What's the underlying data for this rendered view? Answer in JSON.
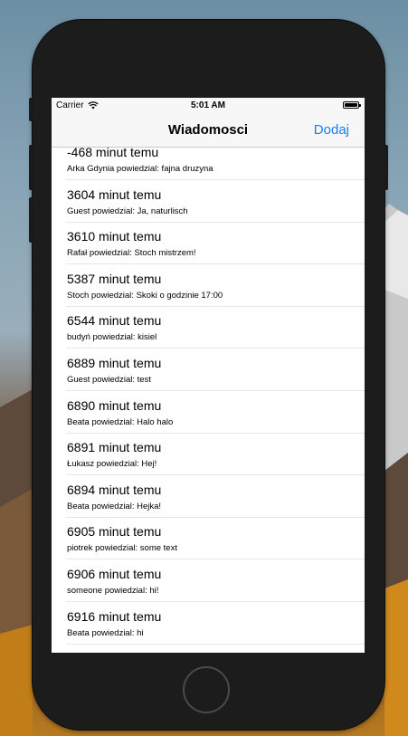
{
  "status_bar": {
    "carrier": "Carrier",
    "time": "5:01 AM",
    "icons": [
      "wifi-icon",
      "battery-icon"
    ]
  },
  "nav": {
    "title": "Wiadomosci",
    "add_label": "Dodaj"
  },
  "messages": [
    {
      "time": "-468 minut temu",
      "text": "Arka Gdynia powiedzial: fajna druzyna"
    },
    {
      "time": "3604 minut temu",
      "text": "Guest powiedzial: Ja, naturlisch"
    },
    {
      "time": "3610 minut temu",
      "text": "Rafał powiedzial: Stoch mistrzem!"
    },
    {
      "time": "5387 minut temu",
      "text": "Stoch powiedzial: Skoki o godzinie 17:00"
    },
    {
      "time": "6544 minut temu",
      "text": "budyń powiedzial: kisiel"
    },
    {
      "time": "6889 minut temu",
      "text": "Guest powiedzial: test"
    },
    {
      "time": "6890 minut temu",
      "text": "Beata powiedzial: Halo halo"
    },
    {
      "time": "6891 minut temu",
      "text": "Łukasz powiedzial: Hej!"
    },
    {
      "time": "6894 minut temu",
      "text": "Beata powiedzial: Hejka!"
    },
    {
      "time": "6905 minut temu",
      "text": "piotrek powiedzial: some text"
    },
    {
      "time": "6906 minut temu",
      "text": "someone powiedzial: hi!"
    },
    {
      "time": "6916 minut temu",
      "text": "Beata powiedzial: hi"
    }
  ],
  "colors": {
    "accent": "#1a7ef5",
    "bar_bg": "#f7f7f7",
    "separator": "#e5e5ea",
    "phone_body": "#1c1c1c"
  }
}
